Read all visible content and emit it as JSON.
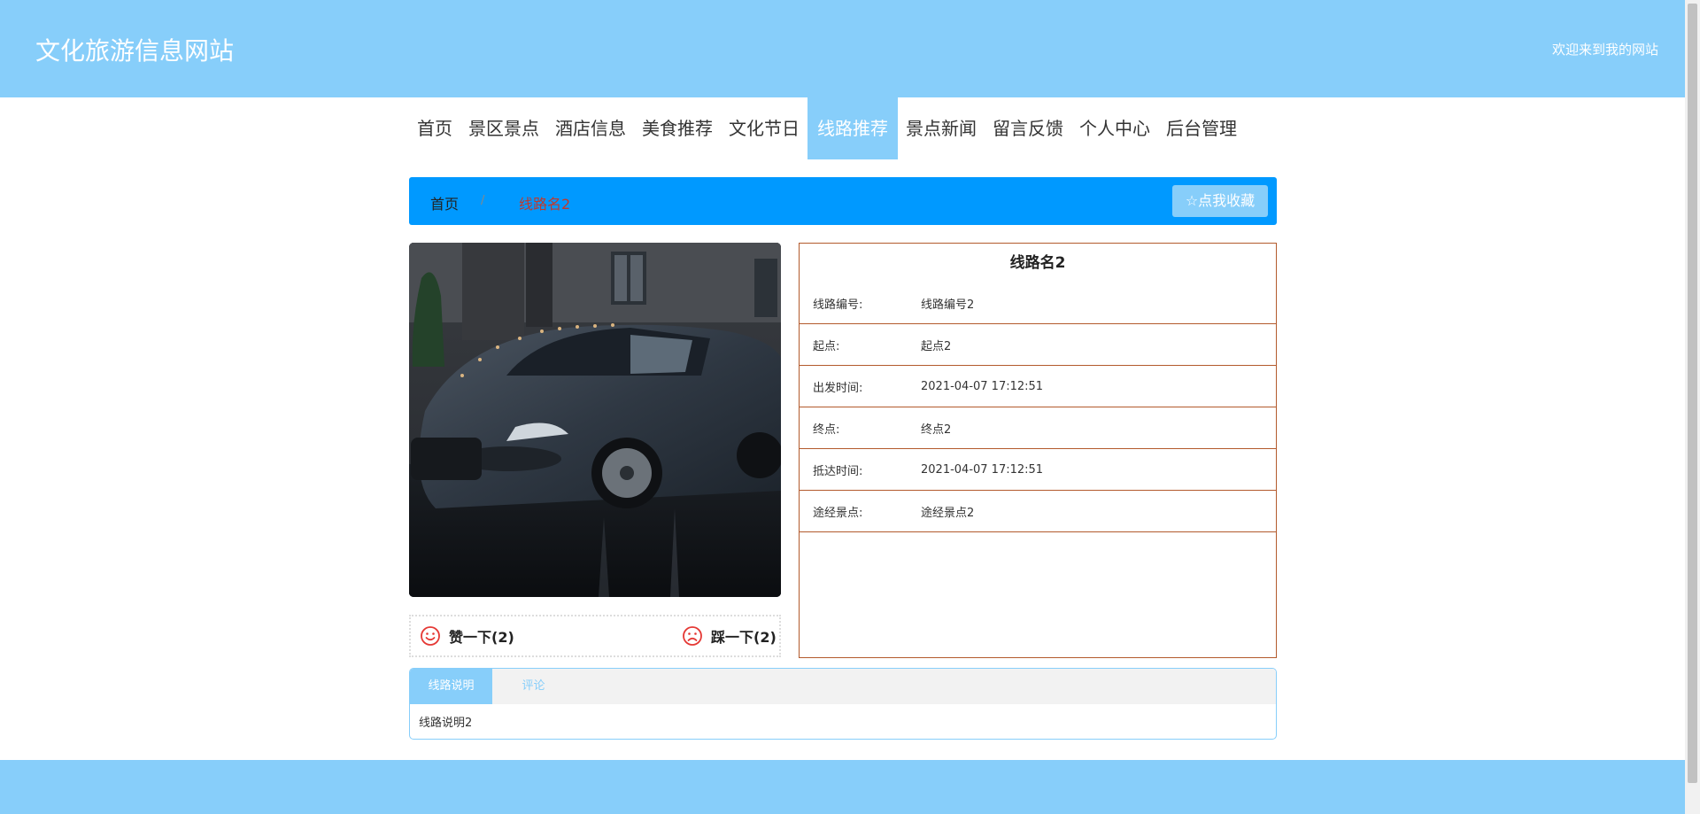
{
  "header": {
    "site_title": "文化旅游信息网站",
    "welcome": "欢迎来到我的网站"
  },
  "nav": {
    "items": [
      {
        "label": "首页"
      },
      {
        "label": "景区景点"
      },
      {
        "label": "酒店信息"
      },
      {
        "label": "美食推荐"
      },
      {
        "label": "文化节日"
      },
      {
        "label": "线路推荐",
        "active": true
      },
      {
        "label": "景点新闻"
      },
      {
        "label": "留言反馈"
      },
      {
        "label": "个人中心"
      },
      {
        "label": "后台管理"
      }
    ]
  },
  "breadcrumb": {
    "home": "首页",
    "separator": "/",
    "current": "线路名2"
  },
  "favorite_button": {
    "icon": "star-outline-icon",
    "label": "☆点我收藏"
  },
  "votes": {
    "up": {
      "icon": "smile-icon",
      "label": "赞一下(2)"
    },
    "down": {
      "icon": "frown-icon",
      "label": "踩一下(2)"
    }
  },
  "detail": {
    "title": "线路名2",
    "rows": [
      {
        "label": "线路编号:",
        "value": "线路编号2"
      },
      {
        "label": "起点:",
        "value": "起点2"
      },
      {
        "label": "出发时间:",
        "value": "2021-04-07 17:12:51"
      },
      {
        "label": "终点:",
        "value": "终点2"
      },
      {
        "label": "抵达时间:",
        "value": "2021-04-07 17:12:51"
      },
      {
        "label": "途经景点:",
        "value": "途经景点2"
      }
    ]
  },
  "tabs": {
    "items": [
      {
        "label": "线路说明",
        "active": true
      },
      {
        "label": "评论"
      }
    ],
    "content": "线路说明2"
  },
  "colors": {
    "header_bg": "#87cefa",
    "breadcrumb_bg": "#0099ff",
    "detail_border": "#b35a2c",
    "vote_icon": "#e53935"
  }
}
